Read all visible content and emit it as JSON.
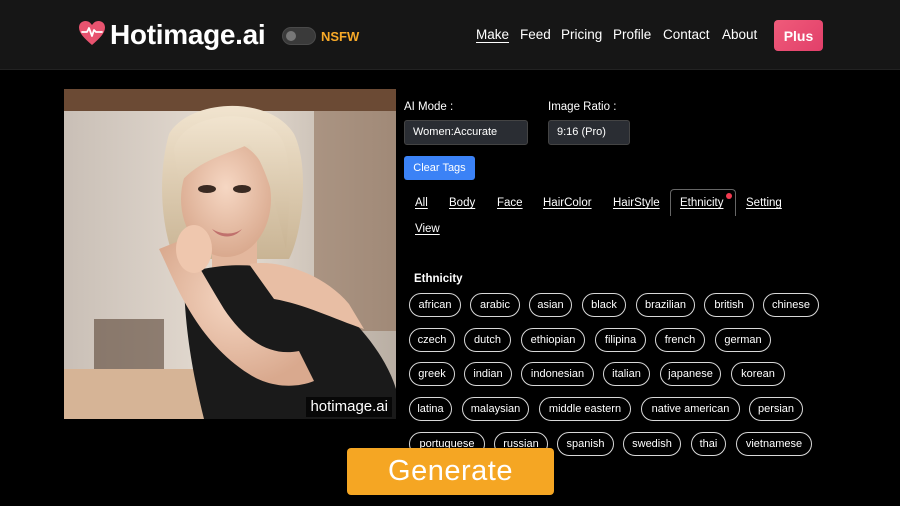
{
  "header": {
    "logo_text": "Hotimage.ai",
    "nsfw_label": "NSFW",
    "nav": [
      "Make",
      "Feed",
      "Pricing",
      "Profile",
      "Contact",
      "About"
    ],
    "plus_label": "Plus"
  },
  "image": {
    "watermark": "hotimage.ai"
  },
  "controls": {
    "ai_mode_label": "AI Mode :",
    "ai_mode_value": "Women:Accurate",
    "ratio_label": "Image Ratio :",
    "ratio_value": "9:16 (Pro)",
    "clear_tags_label": "Clear Tags"
  },
  "tabs": [
    "All",
    "Body",
    "Face",
    "HairColor",
    "HairStyle",
    "Ethnicity",
    "Setting",
    "View"
  ],
  "section_title": "Ethnicity",
  "chips": [
    "african",
    "arabic",
    "asian",
    "black",
    "brazilian",
    "british",
    "chinese",
    "czech",
    "dutch",
    "ethiopian",
    "filipina",
    "french",
    "german",
    "greek",
    "indian",
    "indonesian",
    "italian",
    "japanese",
    "korean",
    "latina",
    "malaysian",
    "middle eastern",
    "native american",
    "persian",
    "portuguese",
    "russian",
    "spanish",
    "swedish",
    "thai",
    "vietnamese"
  ],
  "generate_label": "Generate",
  "colors": {
    "accent_orange": "#f5a623",
    "plus_pink": "#e8486e",
    "clear_blue": "#3b82f6",
    "logo_heart": "#e8536f"
  }
}
